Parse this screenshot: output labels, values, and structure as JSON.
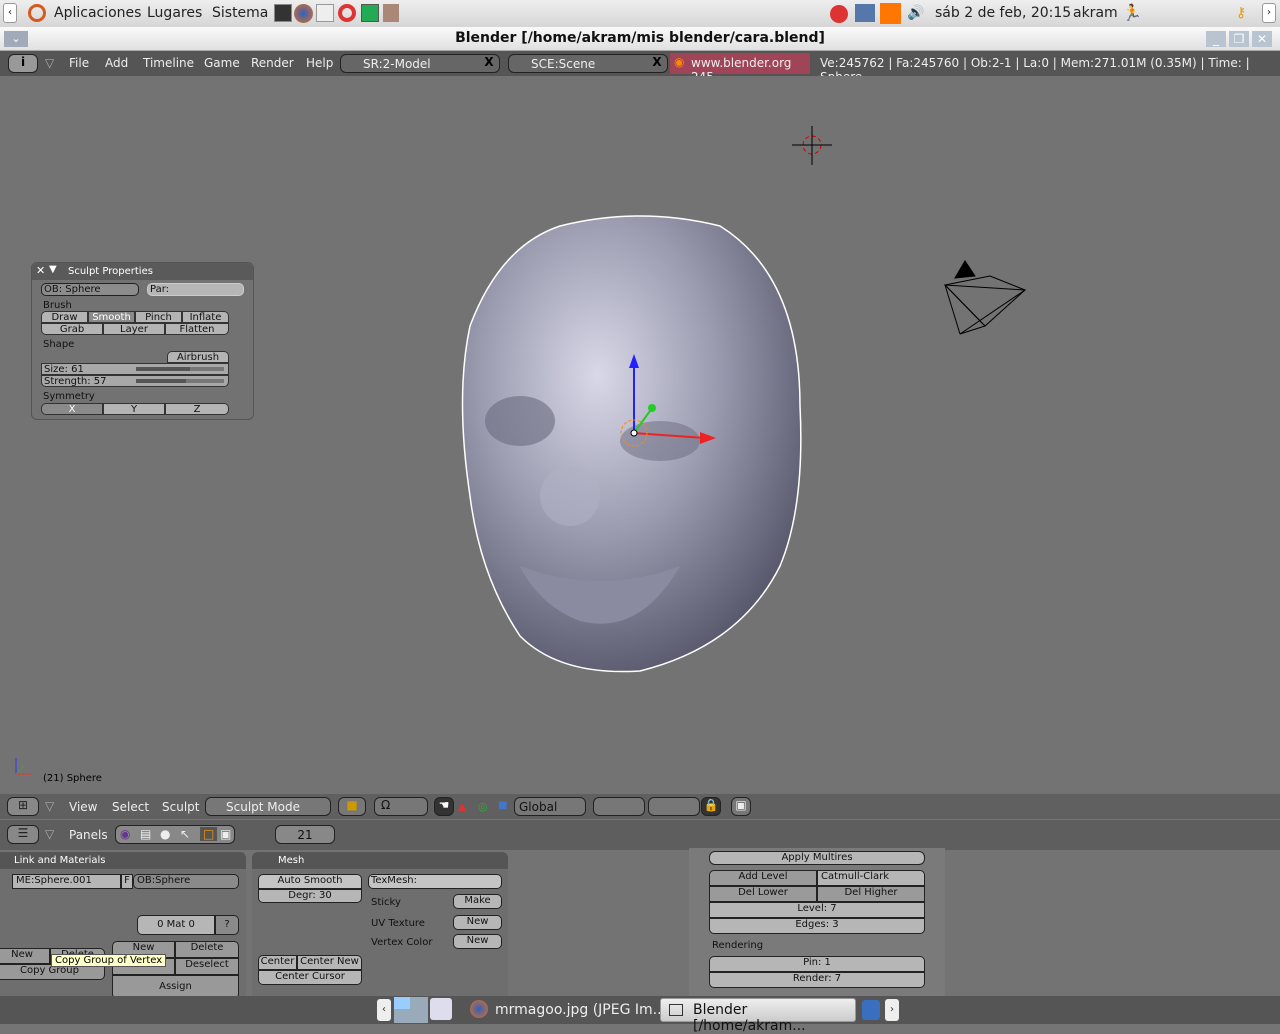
{
  "top_panel": {
    "menus": [
      "Aplicaciones",
      "Lugares",
      "Sistema"
    ],
    "clock": "sáb  2 de feb, 20:15",
    "user": "akram"
  },
  "window": {
    "title": "Blender [/home/akram/mis blender/cara.blend]"
  },
  "blender_header": {
    "menus": [
      "File",
      "Add",
      "Timeline",
      "Game",
      "Render",
      "Help"
    ],
    "screen": "SR:2-Model",
    "scene": "SCE:Scene",
    "site": "www.blender.org 245",
    "stats": "Ve:245762 | Fa:245760 | Ob:2-1 | La:0  | Mem:271.01M (0.35M)  | Time: | Sphere"
  },
  "sculpt_panel": {
    "title": "Sculpt Properties",
    "ob": "OB: Sphere",
    "par": "Par:",
    "brush_label": "Brush",
    "brushes": [
      "Draw",
      "Smooth",
      "Pinch",
      "Inflate",
      "Grab",
      "Layer",
      "Flatten"
    ],
    "active_brush": "Smooth",
    "shape_label": "Shape",
    "airbrush": "Airbrush",
    "size": "Size: 61",
    "size_value": 61,
    "strength": "Strength: 57",
    "strength_value": 57,
    "symmetry_label": "Symmetry",
    "symmetry": [
      "X",
      "Y",
      "Z"
    ]
  },
  "viewport": {
    "object_label": "(21) Sphere"
  },
  "view_header": {
    "menus": [
      "View",
      "Select",
      "Sculpt"
    ],
    "mode": "Sculpt Mode",
    "orientation": "Global"
  },
  "buttons_header": {
    "panels_label": "Panels",
    "frame": "21"
  },
  "link_materials": {
    "title": "Link and Materials",
    "mesh": "ME:Sphere.001",
    "f": "F",
    "ob": "OB:Sphere",
    "mat": "0 Mat 0",
    "q": "?",
    "new": "New",
    "delete": "Delete",
    "copy_group": "Copy Group",
    "tooltip": "Copy Group of Vertex",
    "new2": "New",
    "delete2": "Delete",
    "select": "Select",
    "deselect": "Deselect",
    "assign": "Assign"
  },
  "mesh_panel": {
    "title": "Mesh",
    "auto_smooth": "Auto Smooth",
    "degr": "Degr: 30",
    "texmesh": "TexMesh:",
    "sticky": "Sticky",
    "make": "Make",
    "uv_texture": "UV Texture",
    "uv_new": "New",
    "vertex_color": "Vertex Color",
    "vc_new": "New",
    "center": "Center",
    "center_new": "Center New",
    "center_cursor": "Center Cursor"
  },
  "multires": {
    "apply": "Apply Multires",
    "add_level": "Add Level",
    "subdiv": "Catmull-Clark",
    "del_lower": "Del Lower",
    "del_higher": "Del Higher",
    "level": "Level: 7",
    "edges": "Edges: 3",
    "rendering": "Rendering",
    "pin": "Pin: 1",
    "render": "Render: 7"
  },
  "taskbar": {
    "items": [
      "mrmagoo.jpg (JPEG Im...",
      "Blender [/home/akram..."
    ]
  }
}
